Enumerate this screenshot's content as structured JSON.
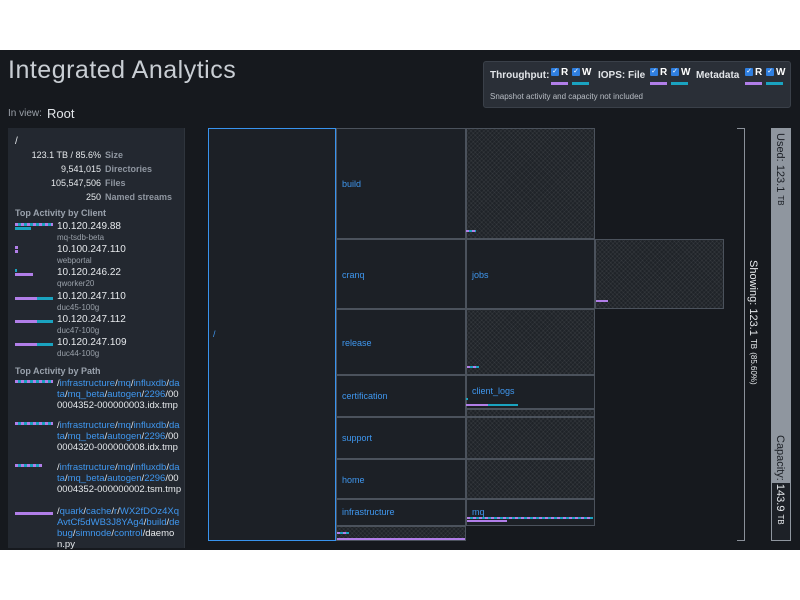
{
  "app": {
    "title": "Integrated Analytics",
    "in_view_label": "In view:",
    "in_view_value": "Root"
  },
  "legend": {
    "throughput_label": "Throughput:",
    "iops_label": "IOPS:",
    "file_label": "File",
    "metadata_label": "Metadata",
    "r": "R",
    "w": "W",
    "note": "Snapshot activity and capacity not included",
    "colors": {
      "read": "#b17ee8",
      "write": "#1aa3c0",
      "checkbox": "#2f7fe0"
    }
  },
  "sidebar": {
    "root": "/",
    "stats": [
      {
        "value": "123.1 TB / 85.6%",
        "label": "Size"
      },
      {
        "value": "9,541,015",
        "label": "Directories"
      },
      {
        "value": "105,547,506",
        "label": "Files"
      },
      {
        "value": "250",
        "label": "Named streams"
      }
    ],
    "clients_heading": "Top Activity by Client",
    "clients": [
      {
        "ip": "10.120.249.88",
        "host": "mq-tsdb-beta"
      },
      {
        "ip": "10.100.247.110",
        "host": "webportal"
      },
      {
        "ip": "10.120.246.22",
        "host": "qworker20"
      },
      {
        "ip": "10.120.247.110",
        "host": "duc45-100g"
      },
      {
        "ip": "10.120.247.112",
        "host": "duc47-100g"
      },
      {
        "ip": "10.120.247.109",
        "host": "duc44-100g"
      }
    ],
    "paths_heading": "Top Activity by Path",
    "paths": [
      {
        "parts": [
          "infrastructure",
          "mq",
          "influxdb",
          "data",
          "mq_beta",
          "autogen",
          "2296"
        ],
        "file": "000004352-000000003.idx.tmp"
      },
      {
        "parts": [
          "infrastructure",
          "mq",
          "influxdb",
          "data",
          "mq_beta",
          "autogen",
          "2296"
        ],
        "file": "000004320-000000008.idx.tmp"
      },
      {
        "parts": [
          "infrastructure",
          "mq",
          "influxdb",
          "data",
          "mq_beta",
          "autogen",
          "2296"
        ],
        "file": "000004352-000000002.tsm.tmp"
      },
      {
        "parts": [
          "quark",
          "cache",
          "r",
          "WX2fDOz4XqAvtCf5dWB3J8YAg4",
          "build",
          "debug",
          "simnode",
          "control"
        ],
        "file": "daemon.py"
      }
    ]
  },
  "treemap": {
    "root_label": "/",
    "dirs": [
      "build",
      "cranq",
      "release",
      "certification",
      "support",
      "home",
      "infrastructure"
    ],
    "subdirs": [
      "jobs",
      "client_logs",
      "mq"
    ]
  },
  "summary": {
    "used_label": "Used:",
    "used_value": "123.1",
    "used_unit": "TB",
    "showing_label": "Showing:",
    "showing_value": "123.1",
    "showing_unit": "TB",
    "showing_pct": "(85.60%)",
    "capacity_label": "Capacity:",
    "capacity_value": "143.9",
    "capacity_unit": "TB",
    "used_fraction": 0.856
  }
}
